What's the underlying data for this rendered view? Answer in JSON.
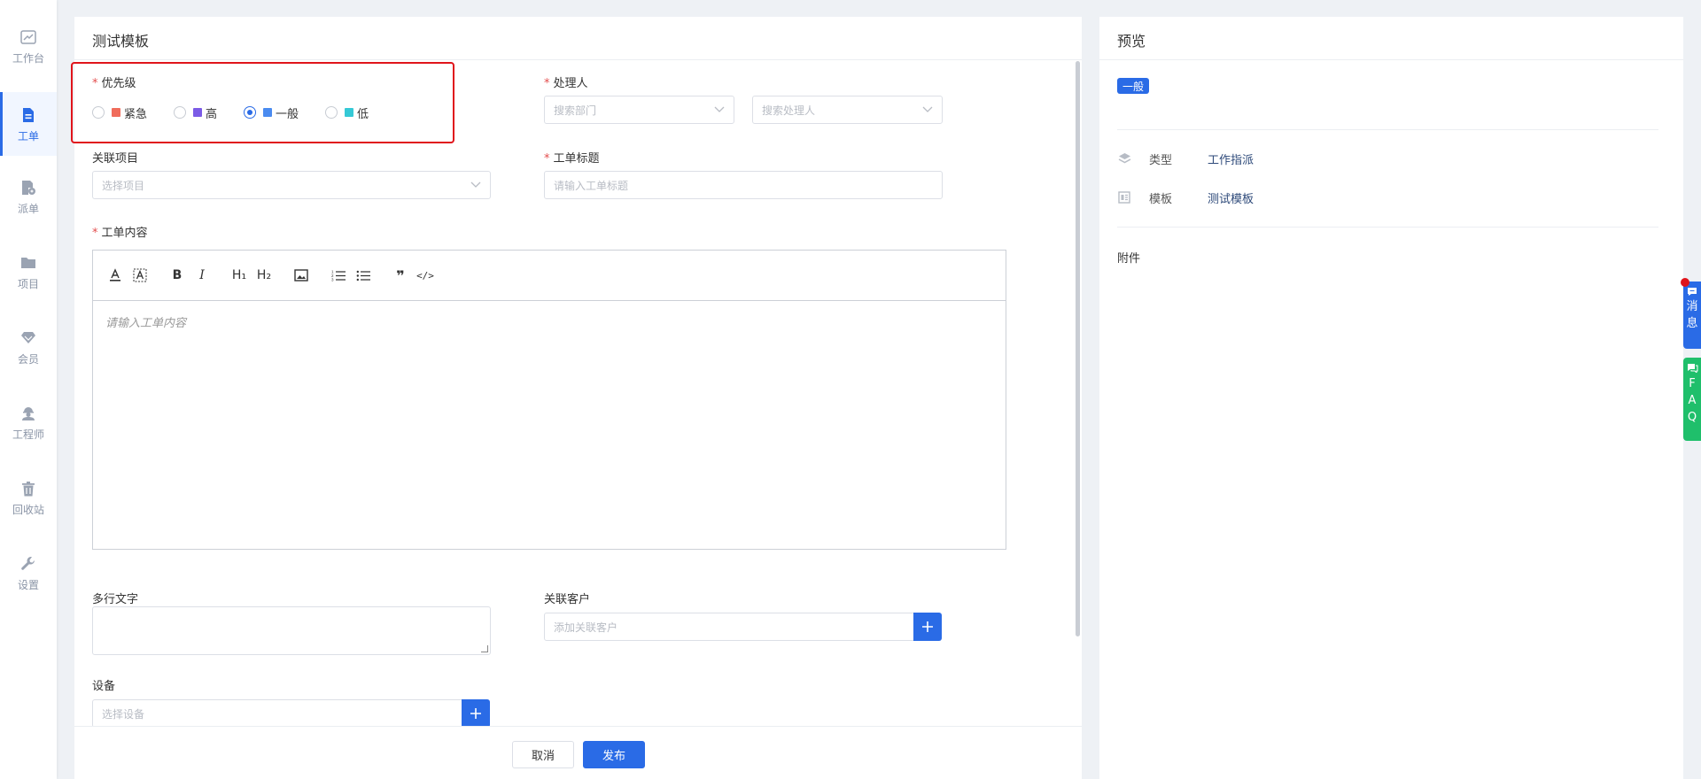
{
  "sidebar": {
    "items": [
      {
        "label": "工作台",
        "icon": "chart-icon"
      },
      {
        "label": "工单",
        "icon": "document-icon",
        "active": true
      },
      {
        "label": "派单",
        "icon": "dispatch-icon"
      },
      {
        "label": "项目",
        "icon": "folder-icon"
      },
      {
        "label": "会员",
        "icon": "diamond-icon"
      },
      {
        "label": "工程师",
        "icon": "engineer-icon"
      },
      {
        "label": "回收站",
        "icon": "trash-icon"
      },
      {
        "label": "设置",
        "icon": "wrench-icon"
      }
    ]
  },
  "form": {
    "title": "测试模板",
    "required_mark": "*",
    "priority": {
      "label": "优先级",
      "options": [
        {
          "label": "紧急",
          "color": "#f06c5b",
          "checked": false
        },
        {
          "label": "高",
          "color": "#7b5be6",
          "checked": false
        },
        {
          "label": "一般",
          "color": "#4a8bf0",
          "checked": true
        },
        {
          "label": "低",
          "color": "#35c9d6",
          "checked": false
        }
      ]
    },
    "handler": {
      "label": "处理人",
      "department_placeholder": "搜索部门",
      "person_placeholder": "搜索处理人"
    },
    "project": {
      "label": "关联项目",
      "placeholder": "选择项目"
    },
    "ticket_title": {
      "label": "工单标题",
      "placeholder": "请输入工单标题"
    },
    "content": {
      "label": "工单内容",
      "placeholder": "请输入工单内容"
    },
    "multiline": {
      "label": "多行文字"
    },
    "customer": {
      "label": "关联客户",
      "placeholder": "添加关联客户"
    },
    "device": {
      "label": "设备",
      "placeholder": "选择设备"
    },
    "cancel_label": "取消",
    "publish_label": "发布"
  },
  "editor_toolbar": {
    "h1": "H₁",
    "h2": "H₂",
    "quote": "❞",
    "code": "</>"
  },
  "preview": {
    "title": "预览",
    "badge": "一般",
    "rows": [
      {
        "key": "类型",
        "value": "工作指派",
        "icon": "layers-icon"
      },
      {
        "key": "模板",
        "value": "测试模板",
        "icon": "template-icon"
      }
    ],
    "attachment_label": "附件"
  },
  "floating": {
    "message_chars": [
      "消",
      "息"
    ],
    "faq_chars": [
      "F",
      "A",
      "Q"
    ]
  },
  "colors": {
    "primary": "#2a6be6",
    "faq_green": "#1fbf6b",
    "highlight_red": "#e0141b"
  }
}
